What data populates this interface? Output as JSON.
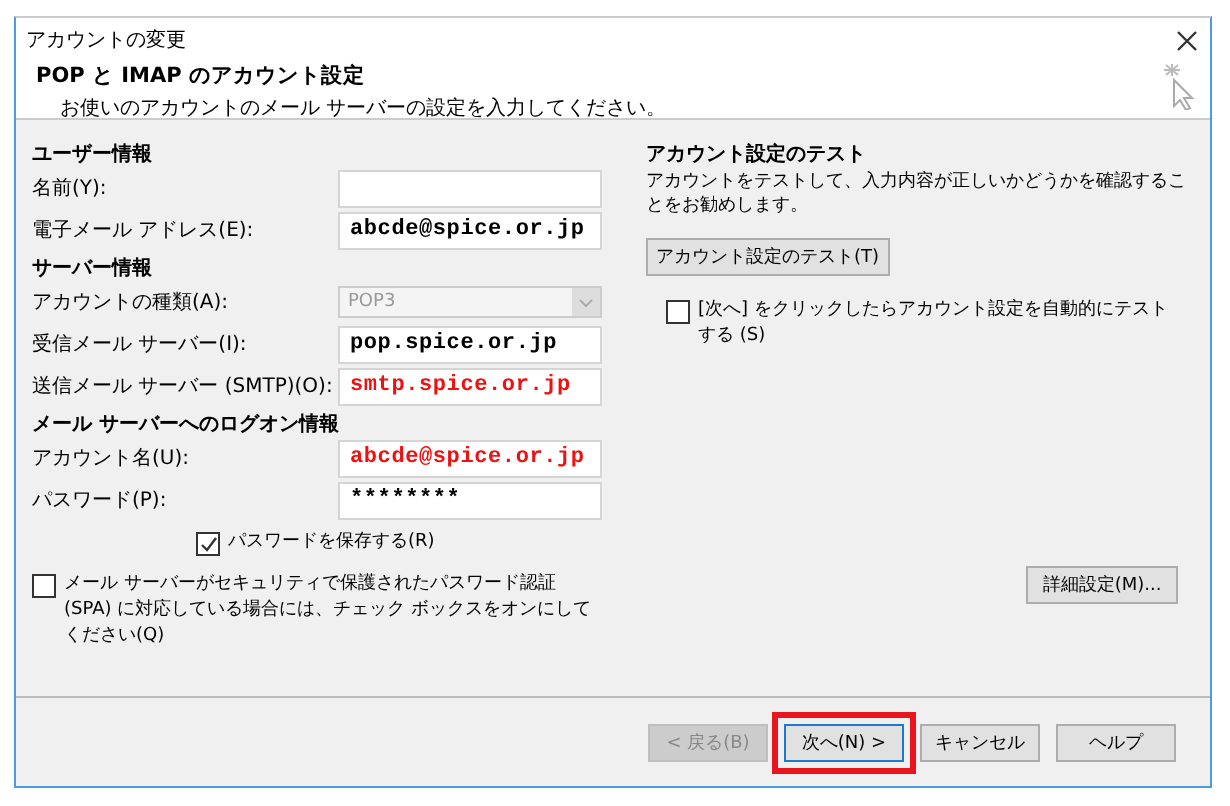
{
  "window": {
    "title": "アカウントの変更"
  },
  "header": {
    "title": "POP と IMAP のアカウント設定",
    "subtitle": "お使いのアカウントのメール サーバーの設定を入力してください。"
  },
  "sections": [
    {
      "heading": "ユーザー情報",
      "rows": [
        {
          "kind": "text",
          "label": "名前(Y):"
        },
        {
          "kind": "text",
          "label": "電子メール アドレス(E):",
          "value": "abcde@spice.or.jp",
          "color": "#000000"
        }
      ]
    },
    {
      "heading": "サーバー情報",
      "rows": [
        {
          "kind": "select",
          "label": "アカウントの種類(A):",
          "value": "POP3",
          "disabled": true
        },
        {
          "kind": "text",
          "label": "受信メール サーバー(I):",
          "value": "pop.spice.or.jp",
          "color": "#000000"
        },
        {
          "kind": "text",
          "label": "送信メール サーバー (SMTP)(O):",
          "value": "smtp.spice.or.jp",
          "color": "#ee1111"
        }
      ]
    },
    {
      "heading": "メール サーバーへのログオン情報",
      "rows": [
        {
          "kind": "text",
          "label": "アカウント名(U):",
          "value": "abcde@spice.or.jp",
          "color": "#ee1111"
        },
        {
          "kind": "text",
          "label": "パスワード(P):",
          "value": "********",
          "color": "#000000"
        }
      ]
    }
  ],
  "save_password": {
    "label": "パスワードを保存する(R)",
    "checked": true
  },
  "spa": {
    "label": "メール サーバーがセキュリティで保護されたパスワード認証 (SPA) に対応している場合には、チェック ボックスをオンにしてください(Q)",
    "checked": false
  },
  "test": {
    "heading": "アカウント設定のテスト",
    "description": "アカウントをテストして、入力内容が正しいかどうかを確認することをお勧めします。",
    "button": "アカウント設定のテスト(T)",
    "auto_test": {
      "label": "[次へ] をクリックしたらアカウント設定を自動的にテストする (S)",
      "checked": false
    }
  },
  "more_settings": "詳細設定(M)...",
  "footer": {
    "buttons": [
      {
        "label": "< 戻る(B)",
        "disabled": true,
        "highlighted": false
      },
      {
        "label": "次へ(N) >",
        "disabled": false,
        "highlighted": true
      },
      {
        "label": "キャンセル",
        "disabled": false,
        "highlighted": false
      },
      {
        "label": "ヘルプ",
        "disabled": false,
        "highlighted": false
      }
    ]
  }
}
